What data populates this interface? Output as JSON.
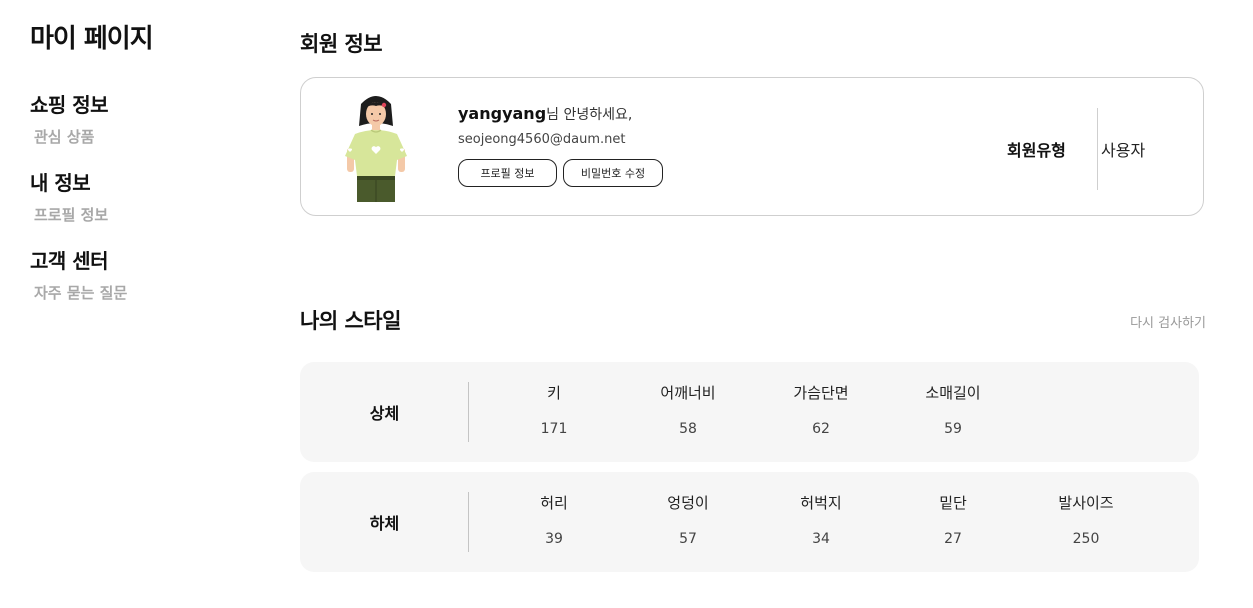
{
  "sidebar": {
    "title": "마이 페이지",
    "sections": [
      {
        "label": "쇼핑 정보",
        "links": [
          "관심 상품"
        ]
      },
      {
        "label": "내 정보",
        "links": [
          "프로필 정보"
        ]
      },
      {
        "label": "고객 센터",
        "links": [
          "자주 묻는 질문"
        ]
      }
    ]
  },
  "member": {
    "section_title": "회원 정보",
    "username": "yangyang",
    "greeting_suffix": "님 안녕하세요,",
    "email": "seojeong4560@daum.net",
    "profile_button": "프로필 정보",
    "password_button": "비밀번호 수정",
    "type_label": "회원유형",
    "type_value": "사용자"
  },
  "style": {
    "section_title": "나의 스타일",
    "retest_label": "다시 검사하기",
    "upper": {
      "label": "상체",
      "headers": [
        "키",
        "어깨너비",
        "가슴단면",
        "소매길이"
      ],
      "values": [
        "171",
        "58",
        "62",
        "59"
      ]
    },
    "lower": {
      "label": "하체",
      "headers": [
        "허리",
        "엉덩이",
        "허벅지",
        "밑단",
        "발사이즈"
      ],
      "values": [
        "39",
        "57",
        "34",
        "27",
        "250"
      ]
    }
  },
  "colors": {
    "border": "#cfcfcf",
    "panel_bg": "#f6f6f6",
    "muted_text": "#a8a8a8",
    "shirt": "#d7e69a",
    "pants": "#4a5a2c"
  }
}
